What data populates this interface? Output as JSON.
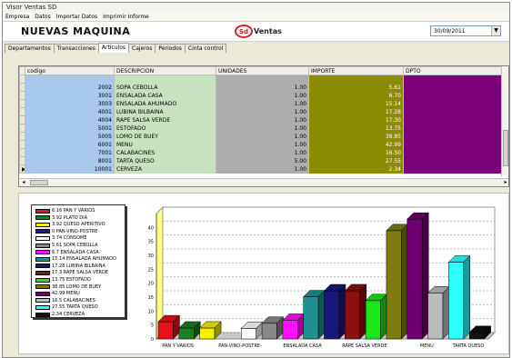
{
  "window": {
    "title": "Visor Ventas SD"
  },
  "menu": [
    "Empresa",
    "Datos",
    "Importar Datos",
    "Imprimir Informe"
  ],
  "header": {
    "company": "NUEVAS MAQUINA",
    "logo_mark": "Sd",
    "logo_text": "Ventas",
    "date": "30/09/2011"
  },
  "tabs": [
    "Departamentos",
    "Transacciones",
    "Articulos",
    "Cajeros",
    "Periodos",
    "Cinta control"
  ],
  "active_tab": "Articulos",
  "table": {
    "columns": [
      "codigo",
      "DESCRIPCION",
      "UNIDADES",
      "IMPORTE",
      "DPTO"
    ],
    "rows": [
      {
        "codigo": "",
        "desc": "",
        "unidades": "",
        "importe": ""
      },
      {
        "codigo": "2002",
        "desc": "SOPA CEBOLLA",
        "unidades": "1.00",
        "importe": "5.61"
      },
      {
        "codigo": "3001",
        "desc": "ENSALADA CASA",
        "unidades": "1.00",
        "importe": "6.70"
      },
      {
        "codigo": "3003",
        "desc": "ENSALADA AHUMADO",
        "unidades": "1.00",
        "importe": "15.14"
      },
      {
        "codigo": "4001",
        "desc": "LUBINA BILBAINA",
        "unidades": "1.00",
        "importe": "17.28"
      },
      {
        "codigo": "4004",
        "desc": "RAPE SALSA VERDE",
        "unidades": "1.00",
        "importe": "17.30"
      },
      {
        "codigo": "5001",
        "desc": "ESTOFADO",
        "unidades": "1.00",
        "importe": "13.75"
      },
      {
        "codigo": "5005",
        "desc": "LOMO DE BUEY",
        "unidades": "1.00",
        "importe": "38.85"
      },
      {
        "codigo": "6001",
        "desc": "MENU",
        "unidades": "1.00",
        "importe": "42.99"
      },
      {
        "codigo": "7001",
        "desc": "CALABACINES",
        "unidades": "1.00",
        "importe": "16.50"
      },
      {
        "codigo": "8001",
        "desc": "TARTA QUESO",
        "unidades": "5.00",
        "importe": "27.55"
      },
      {
        "codigo": "10001",
        "desc": "CERVEZA",
        "unidades": "1.00",
        "importe": "2.34"
      }
    ]
  },
  "chart_data": {
    "type": "bar",
    "categories": [
      "PAN Y VARIOS",
      "PLATO DIA",
      "QUESO APERITIVO",
      "PAN-VINO-POSTRE-",
      "CONSOME",
      "SOPA CEBOLLA",
      "ENSALADA CASA",
      "ENSALADA AHUMADO",
      "LUBINA BILBAINA",
      "RAPE SALSA VERDE",
      "ESTOFADO",
      "LOMO DE BUEY",
      "MENU",
      "CALABACINES",
      "TARTA QUESO",
      "CERVEZA"
    ],
    "values": [
      6.16,
      3.92,
      3.92,
      0,
      3.74,
      5.61,
      6.7,
      15.14,
      17.28,
      17.3,
      13.75,
      38.85,
      42.99,
      16.5,
      27.55,
      2.34
    ],
    "legend_labels": [
      "6.16 PAN Y VARIOS",
      "3.92 PLATO DIA",
      "3.92 QUESO APERITIVO",
      "0 PAN-VINO-POSTRE-",
      "3.74 CONSOME",
      "5.61 SOPA CEBOLLA",
      "6.7 ENSALADA CASA",
      "15.14 ENSALADA AHUMADO",
      "17.28 LUBINA BILBAINA",
      "17.3 RAPE SALSA VERDE",
      "13.75 ESTOFADO",
      "38.85 LOMO DE BUEY",
      "42.99 MENU",
      "16.5 CALABACINES",
      "27.55 TARTA QUESO",
      "2.34 CERVEZA"
    ],
    "colors": [
      "#e8101a",
      "#18801e",
      "#f5f000",
      "#1a1aa0",
      "#ffffff",
      "#888888",
      "#ff10ff",
      "#208f8f",
      "#18187a",
      "#8c1010",
      "#18e818",
      "#7c7c10",
      "#700070",
      "#bcbcbc",
      "#30ffff",
      "#111111"
    ],
    "xtick_labels": [
      "PAN Y VARIOS",
      "PAN-VINO-POSTRE-",
      "ENSALADA CASA",
      "RAPE SALSA VERDE",
      "MENU",
      "TARTA QUESO"
    ],
    "yticks": [
      0,
      5,
      10,
      15,
      20,
      25,
      30,
      35,
      40
    ],
    "ylim": [
      0,
      45
    ],
    "legend_position": "left",
    "grid": true
  }
}
